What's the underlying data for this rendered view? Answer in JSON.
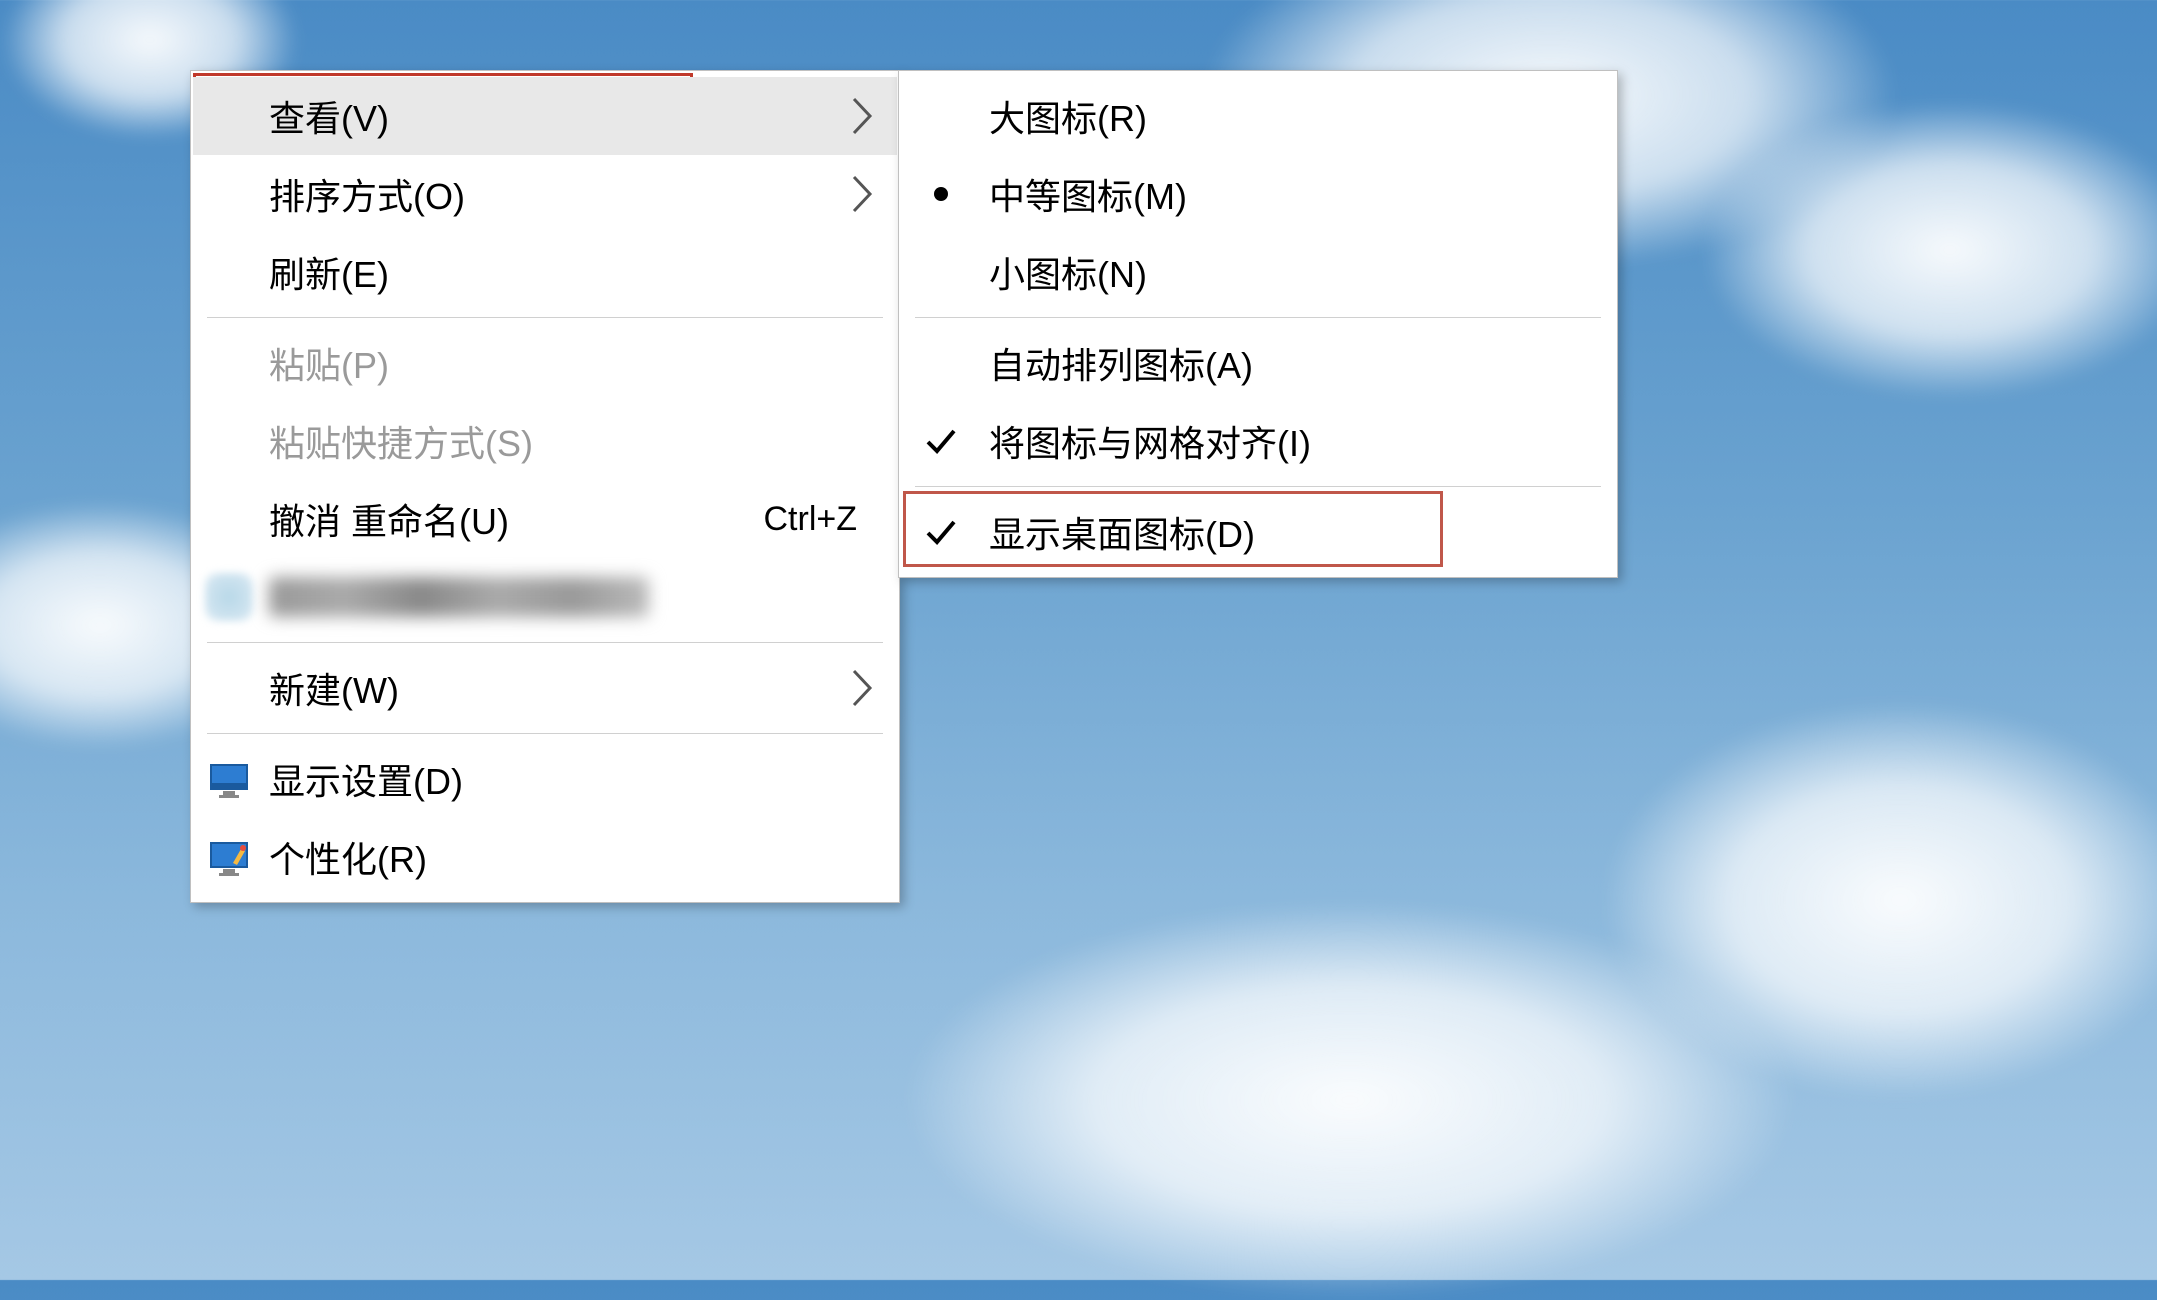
{
  "main_menu": {
    "view": "查看(V)",
    "sort": "排序方式(O)",
    "refresh": "刷新(E)",
    "paste": "粘贴(P)",
    "paste_shortcut": "粘贴快捷方式(S)",
    "undo_rename": "撤消 重命名(U)",
    "undo_rename_key": "Ctrl+Z",
    "new": "新建(W)",
    "display_settings": "显示设置(D)",
    "personalize": "个性化(R)"
  },
  "sub_menu": {
    "large_icons": "大图标(R)",
    "medium_icons": "中等图标(M)",
    "small_icons": "小图标(N)",
    "auto_arrange": "自动排列图标(A)",
    "align_grid": "将图标与网格对齐(I)",
    "show_desktop_icons": "显示桌面图标(D)"
  }
}
